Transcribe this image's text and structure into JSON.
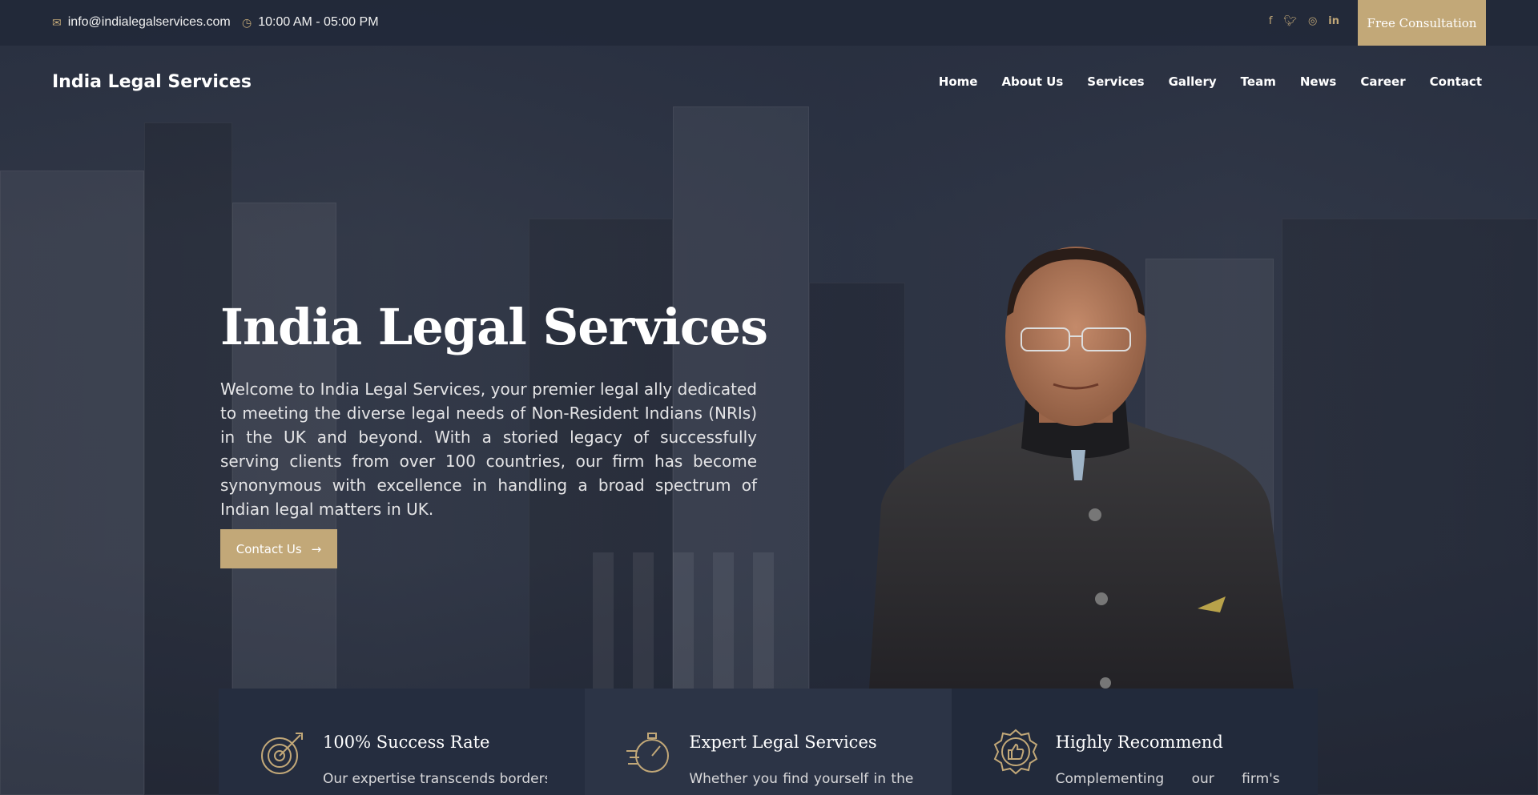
{
  "topbar": {
    "email": "info@indialegalservices.com",
    "hours": "10:00 AM - 05:00 PM",
    "social": [
      "facebook-icon",
      "twitter-icon",
      "instagram-icon",
      "linkedin-icon"
    ],
    "cta_label": "Free Consultation"
  },
  "header": {
    "brand": "India Legal Services",
    "nav": [
      "Home",
      "About Us",
      "Services",
      "Gallery",
      "Team",
      "News",
      "Career",
      "Contact"
    ]
  },
  "hero": {
    "title": "India Legal Services",
    "text": "Welcome to India Legal Services, your premier legal ally dedicated to meeting the diverse legal needs of Non-Resident Indians (NRIs) in the UK and beyond. With a storied legacy of successfully serving clients from over 100 countries, our firm has become synonymous with excellence in handling a broad spectrum of Indian legal matters in UK.",
    "button_label": "Contact Us"
  },
  "features": [
    {
      "icon": "target-icon",
      "title": "100% Success Rate",
      "text": "Our expertise transcends borders,"
    },
    {
      "icon": "stopwatch-icon",
      "title": "Expert Legal Services",
      "text": "Whether you find yourself in the"
    },
    {
      "icon": "thumbs-up-badge-icon",
      "title": "Highly Recommend",
      "text": "Complementing our firm's"
    }
  ],
  "colors": {
    "accent": "#c2a878",
    "background": "#2a3140"
  }
}
